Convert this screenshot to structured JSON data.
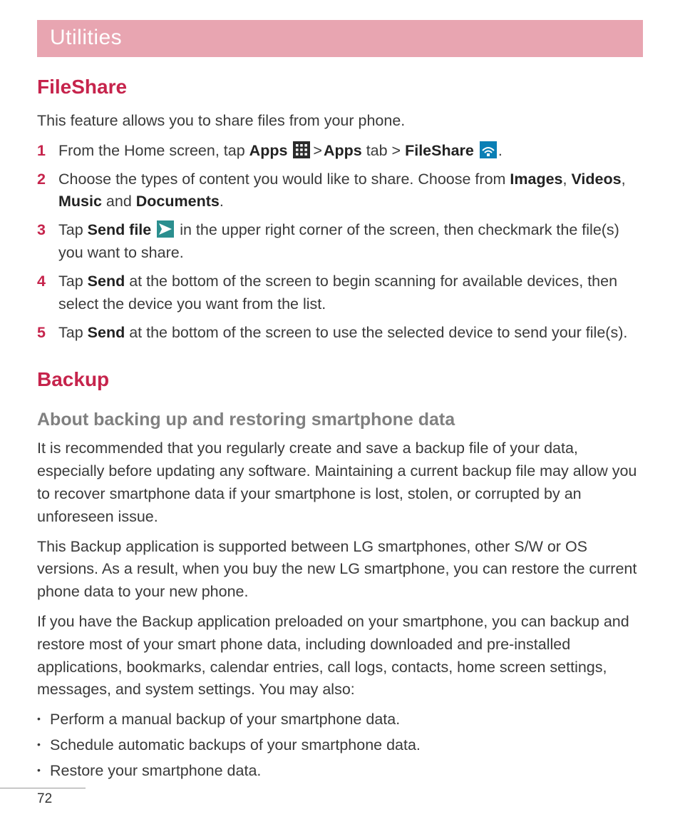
{
  "chapter": "Utilities",
  "section1": {
    "heading": "FileShare",
    "intro": "This feature allows you to share files from your phone.",
    "steps": {
      "s1": {
        "num": "1",
        "pre": "From the Home screen, tap ",
        "apps": "Apps",
        "mid1": " > ",
        "apps_tab": "Apps",
        "tab_word": " tab > ",
        "fileshare": "FileShare",
        "post": "."
      },
      "s2": {
        "num": "2",
        "pre": "Choose the types of content you would like to share. Choose from ",
        "images": "Images",
        "c1": ", ",
        "videos": "Videos",
        "c2": ", ",
        "music": "Music",
        "and": " and ",
        "docs": "Documents",
        "post": "."
      },
      "s3": {
        "num": "3",
        "pre": "Tap ",
        "sendfile": "Send file",
        "post": " in the upper right corner of the screen, then checkmark the file(s) you want to share."
      },
      "s4": {
        "num": "4",
        "pre": "Tap ",
        "send": "Send",
        "post": " at the bottom of the screen to begin scanning for available devices, then select the device you want from the list."
      },
      "s5": {
        "num": "5",
        "pre": "Tap ",
        "send": "Send",
        "post": " at the bottom of the screen to use the selected device to send your file(s)."
      }
    }
  },
  "section2": {
    "heading": "Backup",
    "subheading": "About backing up and restoring smartphone data",
    "p1": "It is recommended that you regularly create and save a backup file of your data, especially before updating any software. Maintaining a current backup file may allow you to recover smartphone data if your smartphone is lost, stolen, or corrupted by an unforeseen issue.",
    "p2": "This Backup application is supported between LG smartphones, other S/W or OS versions. As a result, when you buy the new LG smartphone, you can restore the current phone data to your new phone.",
    "p3": "If you have the Backup application preloaded on your smartphone, you can backup and restore most of your smart phone data, including downloaded and pre-installed applications, bookmarks, calendar entries, call logs, contacts, home screen settings, messages, and system settings. You may also:",
    "bullets": {
      "b1": "Perform a manual backup of your smartphone data.",
      "b2": "Schedule automatic backups of your smartphone data.",
      "b3": "Restore your smartphone data."
    }
  },
  "pageNumber": "72"
}
